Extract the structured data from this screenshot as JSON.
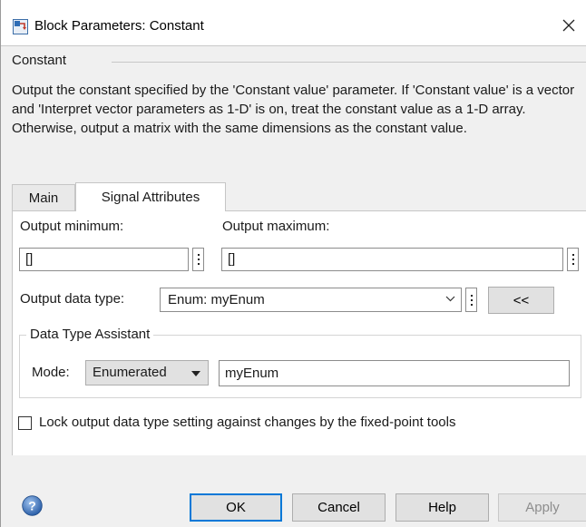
{
  "window": {
    "title": "Block Parameters: Constant",
    "icon": "simulink-block-icon"
  },
  "header": {
    "section": "Constant",
    "description": "Output the constant specified by the 'Constant value' parameter. If 'Constant value' is a vector and 'Interpret vector parameters as 1-D' is on, treat the constant value as a 1-D array. Otherwise, output a matrix with the same dimensions as the constant value."
  },
  "tabs": [
    {
      "label": "Main",
      "active": false
    },
    {
      "label": "Signal Attributes",
      "active": true
    }
  ],
  "signal_attributes": {
    "output_minimum": {
      "label": "Output minimum:",
      "value": "[]"
    },
    "output_maximum": {
      "label": "Output maximum:",
      "value": "[]"
    },
    "output_data_type": {
      "label": "Output data type:",
      "value": "Enum: myEnum"
    },
    "toggle_assistant_label": "<<",
    "assistant": {
      "title": "Data Type Assistant",
      "mode_label": "Mode:",
      "mode_value": "Enumerated",
      "enum_name": "myEnum"
    },
    "lock_checkbox": {
      "label": "Lock output data type setting against changes by the fixed-point tools",
      "checked": false
    }
  },
  "buttons": {
    "ok": "OK",
    "cancel": "Cancel",
    "help": "Help",
    "apply": "Apply"
  },
  "colors": {
    "accent": "#0078d7",
    "panel_bg": "#f0f0f0",
    "disabled_text": "#8d8d8d"
  }
}
